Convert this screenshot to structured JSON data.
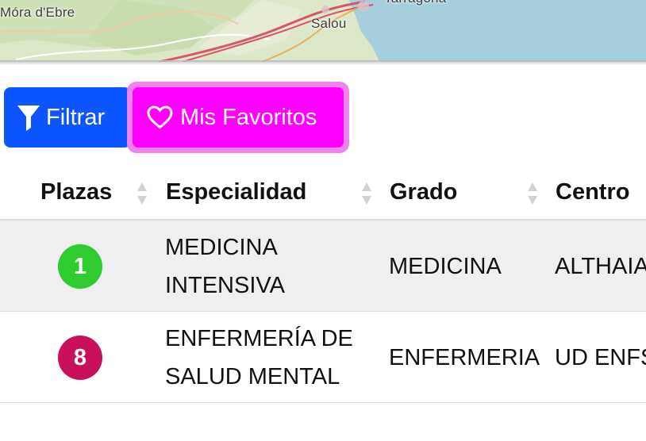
{
  "map": {
    "place_labels": [
      "Móra d'Ebre",
      "Salou",
      "Tarragona"
    ]
  },
  "toolbar": {
    "filter_label": "Filtrar",
    "favorites_label": "Mis Favoritos"
  },
  "table": {
    "columns": [
      "Plazas",
      "Especialidad",
      "Grado",
      "Centro"
    ],
    "rows": [
      {
        "plazas": "1",
        "especialidad_line1": "MEDICINA",
        "especialidad_line2": "INTENSIVA",
        "grado": "MEDICINA",
        "centro": "ALTHAIA"
      },
      {
        "plazas": "8",
        "especialidad_line1": "ENFERMERÍA DE",
        "especialidad_line2": "SALUD MENTAL",
        "grado": "ENFERMERIA",
        "centro": "UD ENFS"
      }
    ]
  },
  "colors": {
    "filter_button": "#0d56ff",
    "favorites_button": "#ff00ff",
    "favorites_outline": "#ee82ee",
    "badge_green": "#2ecc2e",
    "badge_crimson": "#c9105c",
    "row_striped": "#efefef",
    "sea": "#a6cfdc"
  },
  "icons": {
    "filter": "filter-funnel-icon",
    "favorites": "heart-outline-icon",
    "sort": "sort-arrows-icon"
  }
}
